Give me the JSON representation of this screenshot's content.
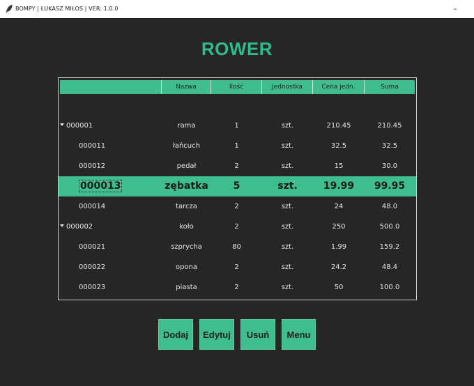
{
  "window": {
    "title": "BOMPY | ŁUKASZ MIŁOS | VER: 1.0.0",
    "minimize_glyph": "–",
    "app_icon": "feather-icon"
  },
  "heading": "ROWER",
  "table": {
    "columns": [
      "",
      "Nazwa",
      "Ilość",
      "Jednostka",
      "Cena jedn.",
      "Suma"
    ],
    "rows": [
      {
        "id": "000001",
        "name": "rama",
        "qty": "1",
        "unit": "szt.",
        "price": "210.45",
        "sum": "210.45"
      },
      {
        "id": "000011",
        "name": "łańcuch",
        "qty": "1",
        "unit": "szt.",
        "price": "32.5",
        "sum": "32.5"
      },
      {
        "id": "000012",
        "name": "pedał",
        "qty": "2",
        "unit": "szt.",
        "price": "15",
        "sum": "30.0"
      },
      {
        "id": "000013",
        "name": "zębatka",
        "qty": "5",
        "unit": "szt.",
        "price": "19.99",
        "sum": "99.95"
      },
      {
        "id": "000014",
        "name": "tarcza",
        "qty": "2",
        "unit": "szt.",
        "price": "24",
        "sum": "48.0"
      },
      {
        "id": "000002",
        "name": "koło",
        "qty": "2",
        "unit": "szt.",
        "price": "250",
        "sum": "500.0"
      },
      {
        "id": "000021",
        "name": "szprycha",
        "qty": "80",
        "unit": "szt.",
        "price": "1.99",
        "sum": "159.2"
      },
      {
        "id": "000022",
        "name": "opona",
        "qty": "2",
        "unit": "szt.",
        "price": "24.2",
        "sum": "48.4"
      },
      {
        "id": "000023",
        "name": "piasta",
        "qty": "2",
        "unit": "szt.",
        "price": "50",
        "sum": "100.0"
      }
    ]
  },
  "buttons": {
    "add": "Dodaj",
    "edit": "Edytuj",
    "delete": "Usuń",
    "menu": "Menu"
  },
  "colors": {
    "accent": "#3fbd8f",
    "heading": "#2fbb8b",
    "background": "#262626"
  }
}
